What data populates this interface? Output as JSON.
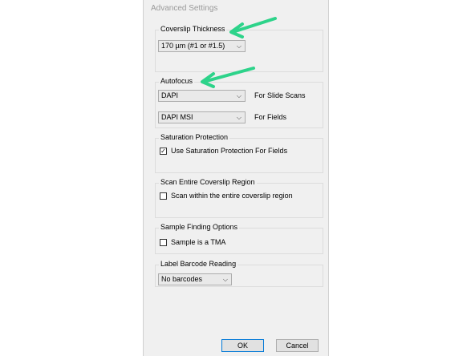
{
  "dialog": {
    "title": "Advanced Settings"
  },
  "coverslip": {
    "label": "Coverslip Thickness",
    "value": "170 µm (#1 or #1.5)"
  },
  "autofocus": {
    "label": "Autofocus",
    "slide_scans": {
      "value": "DAPI",
      "label": "For Slide Scans"
    },
    "fields": {
      "value": "DAPI MSI",
      "label": "For Fields"
    }
  },
  "saturation": {
    "label": "Saturation Protection",
    "checkbox_label": "Use Saturation Protection For Fields",
    "checked": true,
    "check_mark": "✓"
  },
  "scan_region": {
    "label": "Scan Entire Coverslip Region",
    "checkbox_label": "Scan within the entire coverslip region",
    "checked": false
  },
  "sample_finding": {
    "label": "Sample Finding Options",
    "checkbox_label": "Sample is a TMA",
    "checked": false
  },
  "barcode": {
    "label": "Label Barcode Reading",
    "value": "No barcodes"
  },
  "buttons": {
    "ok": "OK",
    "cancel": "Cancel"
  },
  "annotation_color": "#2dd38a"
}
